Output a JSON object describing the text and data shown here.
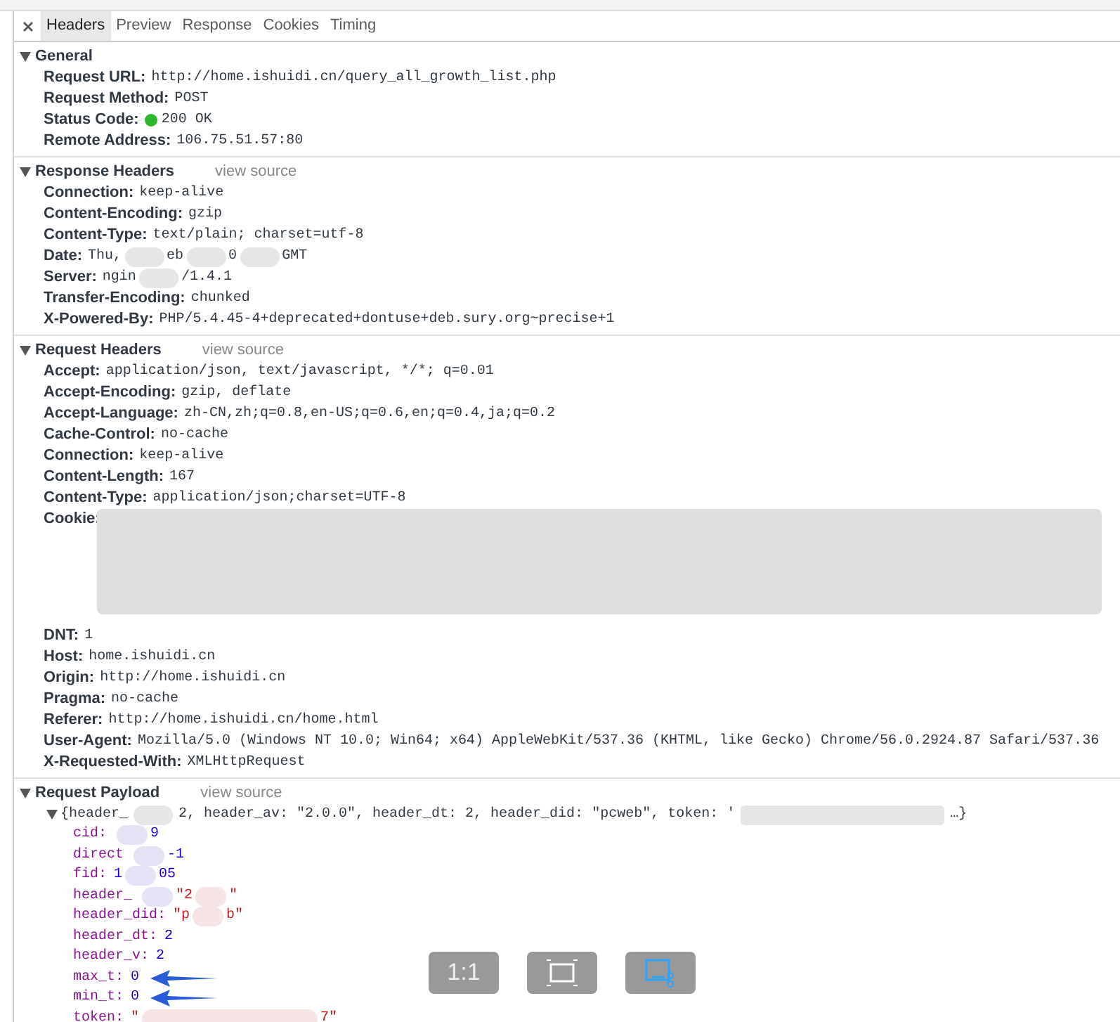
{
  "tabs": [
    {
      "label": "Headers",
      "selected": true
    },
    {
      "label": "Preview",
      "selected": false
    },
    {
      "label": "Response",
      "selected": false
    },
    {
      "label": "Cookies",
      "selected": false
    },
    {
      "label": "Timing",
      "selected": false
    }
  ],
  "sections": [
    {
      "title": "General",
      "expanded": true,
      "rows": [
        {
          "kind": "header",
          "name": "Request URL:",
          "value": "http://home.ishuidi.cn/query_all_growth_list.php"
        },
        {
          "kind": "header",
          "name": "Request Method:",
          "value": "POST"
        },
        {
          "kind": "header",
          "name": "Status Code:",
          "color": "#2fb62f",
          "value": "200 OK"
        },
        {
          "kind": "header",
          "name": "Remote Address:",
          "value": "106.75.51.57:80"
        }
      ]
    },
    {
      "title": "Response Headers",
      "view_source": "view source",
      "expanded": true,
      "rows": [
        {
          "kind": "header",
          "name": "Connection:",
          "value": "keep-alive"
        },
        {
          "kind": "header",
          "name": "Content-Encoding:",
          "value": "gzip"
        },
        {
          "kind": "header",
          "name": "Content-Type:",
          "value": "text/plain; charset=utf-8"
        },
        {
          "kind": "header",
          "name": "Date:",
          "segments": [
            {
              "kind": "text",
              "text": "Thu,"
            },
            {
              "kind": "redacted"
            },
            {
              "kind": "text",
              "text": "eb"
            },
            {
              "kind": "redacted"
            },
            {
              "kind": "text",
              "text": "0"
            },
            {
              "kind": "redacted"
            },
            {
              "kind": "text",
              "text": "GMT"
            }
          ]
        },
        {
          "kind": "header",
          "name": "Server:",
          "segments": [
            {
              "kind": "text",
              "text": "ngin"
            },
            {
              "kind": "redacted"
            },
            {
              "kind": "text",
              "text": "/1.4.1"
            }
          ]
        },
        {
          "kind": "header",
          "name": "Transfer-Encoding:",
          "value": "chunked"
        },
        {
          "kind": "header",
          "name": "X-Powered-By:",
          "value": "PHP/5.4.45-4+deprecated+dontuse+deb.sury.org~precise+1"
        }
      ]
    },
    {
      "title": "Request Headers",
      "view_source": "view source",
      "expanded": true,
      "rows": [
        {
          "kind": "header",
          "name": "Accept:",
          "value": "application/json, text/javascript, */*; q=0.01"
        },
        {
          "kind": "header",
          "name": "Accept-Encoding:",
          "value": "gzip, deflate"
        },
        {
          "kind": "header",
          "name": "Accept-Language:",
          "value": "zh-CN,zh;q=0.8,en-US;q=0.6,en;q=0.4,ja;q=0.2"
        },
        {
          "kind": "header",
          "name": "Cache-Control:",
          "value": "no-cache"
        },
        {
          "kind": "header",
          "name": "Connection:",
          "value": "keep-alive"
        },
        {
          "kind": "header",
          "name": "Content-Length:",
          "value": "167"
        },
        {
          "kind": "header",
          "name": "Content-Type:",
          "value": "application/json;charset=UTF-8"
        },
        {
          "kind": "header",
          "name": "Cookie:",
          "segments": [
            {
              "kind": "redacted-block"
            }
          ]
        },
        {
          "kind": "header",
          "name": "DNT:",
          "value": "1"
        },
        {
          "kind": "header",
          "name": "Host:",
          "value": "home.ishuidi.cn"
        },
        {
          "kind": "header",
          "name": "Origin:",
          "value": "http://home.ishuidi.cn"
        },
        {
          "kind": "header",
          "name": "Pragma:",
          "value": "no-cache"
        },
        {
          "kind": "header",
          "name": "Referer:",
          "value": "http://home.ishuidi.cn/home.html"
        },
        {
          "kind": "header",
          "name": "User-Agent:",
          "value": "Mozilla/5.0 (Windows NT 10.0; Win64; x64) AppleWebKit/537.36 (KHTML, like Gecko) Chrome/56.0.2924.87 Safari/537.36"
        },
        {
          "kind": "header",
          "name": "X-Requested-With:",
          "value": "XMLHttpRequest"
        }
      ]
    },
    {
      "title": "Request Payload",
      "view_source": "view source",
      "expanded": true,
      "rows": [
        {
          "kind": "summary",
          "expanded": true,
          "segments": [
            {
              "kind": "text",
              "text": "{header_"
            },
            {
              "kind": "redacted"
            },
            {
              "kind": "text",
              "text": "2, header_av: \"2.0.0\", header_dt: 2, header_did: \"pcweb\", token: '"
            },
            {
              "kind": "redacted-long"
            },
            {
              "kind": "text",
              "text": "…}"
            }
          ]
        },
        {
          "kind": "prop",
          "segments": [
            {
              "kind": "key",
              "text": "cid:"
            },
            {
              "kind": "redacted-violet"
            },
            {
              "kind": "num",
              "text": "9"
            }
          ]
        },
        {
          "kind": "prop",
          "segments": [
            {
              "kind": "key",
              "text": "direct"
            },
            {
              "kind": "redacted-violet"
            },
            {
              "kind": "num",
              "text": "-1"
            }
          ]
        },
        {
          "kind": "prop",
          "segments": [
            {
              "kind": "key",
              "text": "fid:"
            },
            {
              "kind": "num",
              "text": "1"
            },
            {
              "kind": "redacted-violet"
            },
            {
              "kind": "num",
              "text": "05"
            }
          ]
        },
        {
          "kind": "prop",
          "segments": [
            {
              "kind": "key",
              "text": "header_"
            },
            {
              "kind": "redacted-violet"
            },
            {
              "kind": "str",
              "text": "\"2"
            },
            {
              "kind": "redacted-pink"
            },
            {
              "kind": "str",
              "text": "\""
            }
          ]
        },
        {
          "kind": "prop",
          "segments": [
            {
              "kind": "key",
              "text": "header_did:"
            },
            {
              "kind": "str",
              "text": "\"p"
            },
            {
              "kind": "redacted-pink"
            },
            {
              "kind": "str",
              "text": "b\""
            }
          ]
        },
        {
          "kind": "prop",
          "segments": [
            {
              "kind": "key",
              "text": "header_dt:"
            },
            {
              "kind": "num",
              "text": "2"
            }
          ]
        },
        {
          "kind": "prop",
          "segments": [
            {
              "kind": "key",
              "text": "header_v:"
            },
            {
              "kind": "num",
              "text": "2"
            }
          ]
        },
        {
          "kind": "prop",
          "arrow": true,
          "segments": [
            {
              "kind": "key",
              "text": "max_t:"
            },
            {
              "kind": "num",
              "text": "0"
            }
          ]
        },
        {
          "kind": "prop",
          "arrow": true,
          "segments": [
            {
              "kind": "key",
              "text": "min_t:"
            },
            {
              "kind": "num",
              "text": "0"
            }
          ]
        },
        {
          "kind": "prop",
          "segments": [
            {
              "kind": "key",
              "text": "token:"
            },
            {
              "kind": "str",
              "text": "\""
            },
            {
              "kind": "redacted-pink-long"
            },
            {
              "kind": "str",
              "text": "7\""
            }
          ]
        }
      ]
    }
  ],
  "overlay_buttons": [
    {
      "kind": "text",
      "label": "1:1"
    },
    {
      "kind": "fit"
    },
    {
      "kind": "snip"
    }
  ]
}
